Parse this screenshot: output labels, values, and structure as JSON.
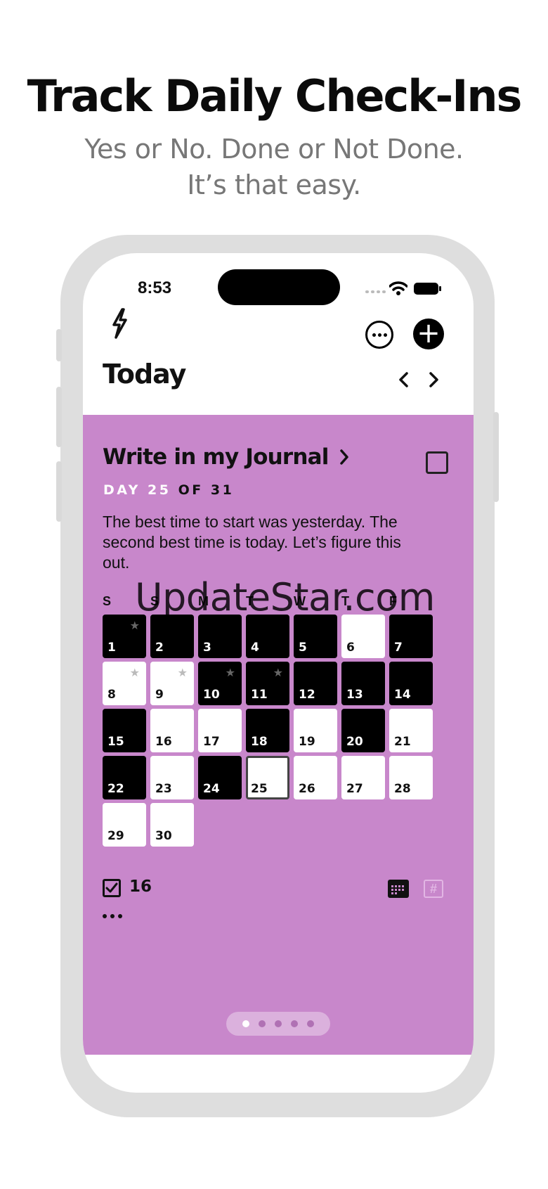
{
  "promo": {
    "headline": "Track Daily Check-Ins",
    "subline_1": "Yes or No. Done or Not Done.",
    "subline_2": "It’s that easy."
  },
  "status_bar": {
    "time": "8:53"
  },
  "header": {
    "title": "Today",
    "prev_icon": "chevron-left-icon",
    "next_icon": "chevron-right-icon"
  },
  "habit": {
    "title": "Write in my Journal",
    "day_label": "DAY",
    "day_current": "25",
    "day_of": "OF",
    "day_total": "31",
    "description": "The best time to start was yesterday. The second best time is today. Let’s figure this out.",
    "card_color": "#c887cb",
    "weekdays": [
      "S",
      "S",
      "M",
      "T",
      "W",
      "T",
      "F"
    ],
    "days": [
      {
        "num": "1",
        "state": "done",
        "star": true
      },
      {
        "num": "2",
        "state": "done",
        "star": false
      },
      {
        "num": "3",
        "state": "done",
        "star": false
      },
      {
        "num": "4",
        "state": "done",
        "star": false
      },
      {
        "num": "5",
        "state": "done",
        "star": false
      },
      {
        "num": "6",
        "state": "missed",
        "star": false
      },
      {
        "num": "7",
        "state": "done",
        "star": false
      },
      {
        "num": "8",
        "state": "missed",
        "star": true
      },
      {
        "num": "9",
        "state": "missed",
        "star": true
      },
      {
        "num": "10",
        "state": "done",
        "star": true
      },
      {
        "num": "11",
        "state": "done",
        "star": true
      },
      {
        "num": "12",
        "state": "done",
        "star": false
      },
      {
        "num": "13",
        "state": "done",
        "star": false
      },
      {
        "num": "14",
        "state": "done",
        "star": false
      },
      {
        "num": "15",
        "state": "done",
        "star": false
      },
      {
        "num": "16",
        "state": "missed",
        "star": false
      },
      {
        "num": "17",
        "state": "missed",
        "star": false
      },
      {
        "num": "18",
        "state": "done",
        "star": false
      },
      {
        "num": "19",
        "state": "missed",
        "star": false
      },
      {
        "num": "20",
        "state": "done",
        "star": false
      },
      {
        "num": "21",
        "state": "missed",
        "star": false
      },
      {
        "num": "22",
        "state": "done",
        "star": false
      },
      {
        "num": "23",
        "state": "missed",
        "star": false
      },
      {
        "num": "24",
        "state": "done",
        "star": false
      },
      {
        "num": "25",
        "state": "today",
        "star": false
      },
      {
        "num": "26",
        "state": "missed",
        "star": false
      },
      {
        "num": "27",
        "state": "missed",
        "star": false
      },
      {
        "num": "28",
        "state": "missed",
        "star": false
      },
      {
        "num": "29",
        "state": "missed",
        "star": false
      },
      {
        "num": "30",
        "state": "missed",
        "star": false
      }
    ],
    "done_count": "16"
  },
  "pager": {
    "count": 5,
    "active": 0
  },
  "watermark": "UpdateStar.com"
}
